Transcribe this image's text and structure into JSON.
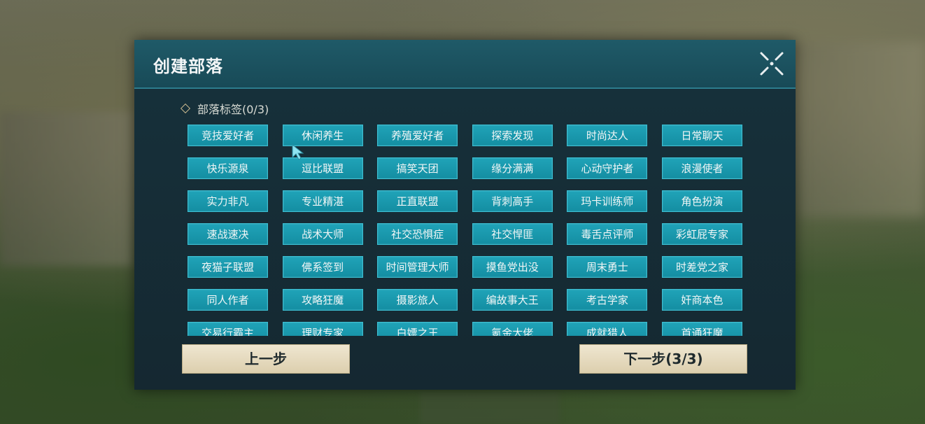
{
  "dialog": {
    "title": "创建部落",
    "section_label": "部落标签(0/3)",
    "tags": [
      "竞技爱好者",
      "休闲养生",
      "养殖爱好者",
      "探索发现",
      "时尚达人",
      "日常聊天",
      "快乐源泉",
      "逗比联盟",
      "搞笑天团",
      "缘分满满",
      "心动守护者",
      "浪漫使者",
      "实力非凡",
      "专业精湛",
      "正直联盟",
      "背刺高手",
      "玛卡训练师",
      "角色扮演",
      "速战速决",
      "战术大师",
      "社交恐惧症",
      "社交悍匪",
      "毒舌点评师",
      "彩虹屁专家",
      "夜猫子联盟",
      "佛系签到",
      "时间管理大师",
      "摸鱼党出没",
      "周末勇士",
      "时差党之家",
      "同人作者",
      "攻略狂魔",
      "摄影旅人",
      "编故事大王",
      "考古学家",
      "奸商本色",
      "交易行霸主",
      "理财专家",
      "白嫖之王",
      "氪金大佬",
      "成就猎人",
      "首通狂魔"
    ],
    "prev_label": "上一步",
    "next_label": "下一步(3/3)"
  },
  "icons": {
    "close": "close-icon",
    "cursor": "pointer-cursor-icon"
  },
  "colors": {
    "tag_bg": "#1798ad",
    "header_bg": "#1f5a68",
    "panel_bg": "#16303a",
    "button_bg": "#e6dcc0"
  }
}
